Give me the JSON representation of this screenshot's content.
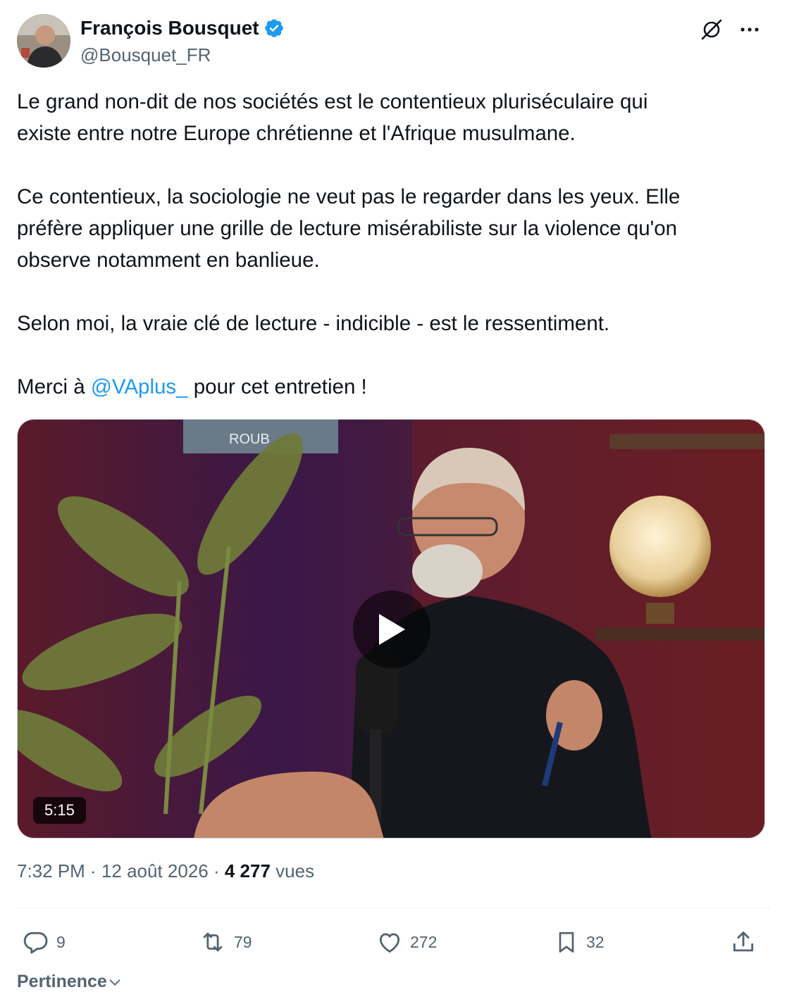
{
  "author": {
    "display_name": "François Bousquet",
    "handle": "@Bousquet_FR",
    "verified": true,
    "avatar_icon": "user-avatar"
  },
  "header_icons": [
    "grok-icon",
    "more-options-icon"
  ],
  "tweet": {
    "paragraph1_line1": "Le grand non-dit de nos sociétés est le contentieux pluriséculaire qui",
    "paragraph1_line2": "existe entre notre Europe chrétienne et l'Afrique musulmane.",
    "paragraph2_line1": "Ce contentieux, la sociologie ne veut pas le regarder dans les yeux. Elle",
    "paragraph2_line2": "préfère appliquer une grille de lecture misérabiliste sur la violence qu'on",
    "paragraph2_line3": "observe notamment en banlieue.",
    "paragraph3": "Selon moi, la vraie clé de lecture - indicible - est le ressentiment.",
    "paragraph4_before": "Merci à ",
    "paragraph4_mention": "@VAplus_",
    "paragraph4_after": " pour cet entretien !"
  },
  "media": {
    "duration": "5:15",
    "play_icon": "play-icon",
    "poster_sign": "ROUB"
  },
  "meta": {
    "time": "7:32 PM",
    "separator": " · ",
    "date": "12 août 2026",
    "views_count": "4 277",
    "views_label": " vues"
  },
  "actions": {
    "replies": "9",
    "reposts": "79",
    "likes": "272",
    "bookmarks": "32"
  },
  "sort": {
    "label": "Pertinence"
  },
  "colors": {
    "accent": "#1d9bf0",
    "text": "#0f1419",
    "secondary": "#536471"
  }
}
